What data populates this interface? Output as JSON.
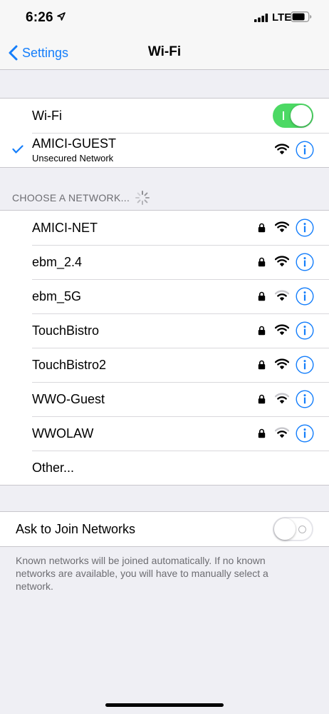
{
  "status_bar": {
    "time": "6:26",
    "carrier": "LTE"
  },
  "nav": {
    "back_label": "Settings",
    "title": "Wi-Fi"
  },
  "wifi": {
    "label": "Wi-Fi",
    "enabled": true
  },
  "connected": {
    "name": "AMICI-GUEST",
    "subtitle": "Unsecured Network",
    "secured": false,
    "signal_bars": 3
  },
  "section_header": "CHOOSE A NETWORK...",
  "networks": [
    {
      "name": "AMICI-NET",
      "secured": true,
      "signal_bars": 3
    },
    {
      "name": "ebm_2.4",
      "secured": true,
      "signal_bars": 3
    },
    {
      "name": "ebm_5G",
      "secured": true,
      "signal_bars": 2
    },
    {
      "name": "TouchBistro",
      "secured": true,
      "signal_bars": 3
    },
    {
      "name": "TouchBistro2",
      "secured": true,
      "signal_bars": 3
    },
    {
      "name": "WWO-Guest",
      "secured": true,
      "signal_bars": 2
    },
    {
      "name": "WWOLAW",
      "secured": true,
      "signal_bars": 2
    }
  ],
  "other_label": "Other...",
  "ask_to_join": {
    "label": "Ask to Join Networks",
    "enabled": false
  },
  "footer_note": "Known networks will be joined automatically. If no known networks are available, you will have to manually select a network.",
  "colors": {
    "accent": "#147efb",
    "toggle_on": "#4cd964",
    "background": "#efeff4"
  },
  "icons": {
    "location": "location-arrow-icon",
    "signal": "cellular-signal-icon",
    "battery": "battery-icon",
    "back": "chevron-left-icon",
    "lock": "lock-icon",
    "wifi": "wifi-icon",
    "info": "info-icon",
    "check": "checkmark-icon",
    "spinner": "loading-spinner-icon"
  }
}
